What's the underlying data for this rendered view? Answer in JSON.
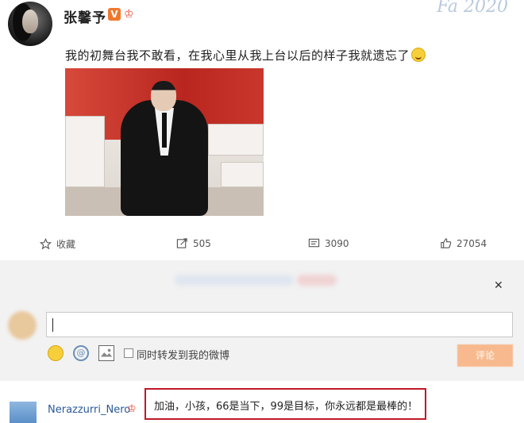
{
  "post": {
    "username": "张馨予",
    "verified_badge": "V",
    "text": "我的初舞台我不敢看，在我心里从我上台以后的样子我就遗忘了",
    "watermark": "Fa 2020"
  },
  "actions": {
    "favorite_label": "收藏",
    "repost_count": "505",
    "comment_count": "3090",
    "like_count": "27054"
  },
  "comment_box": {
    "close_icon": "close-icon",
    "forward_option": "同时转发到我的微博",
    "post_button": "评论"
  },
  "reply": {
    "user": "Nerazzurri_Nero",
    "text": "加油，小孩，66是当下，99是目标，你永远都是最棒的！"
  },
  "colors": {
    "accent_orange": "#f0782d",
    "highlight_red": "#c01828",
    "link_blue": "#2a5a99"
  }
}
